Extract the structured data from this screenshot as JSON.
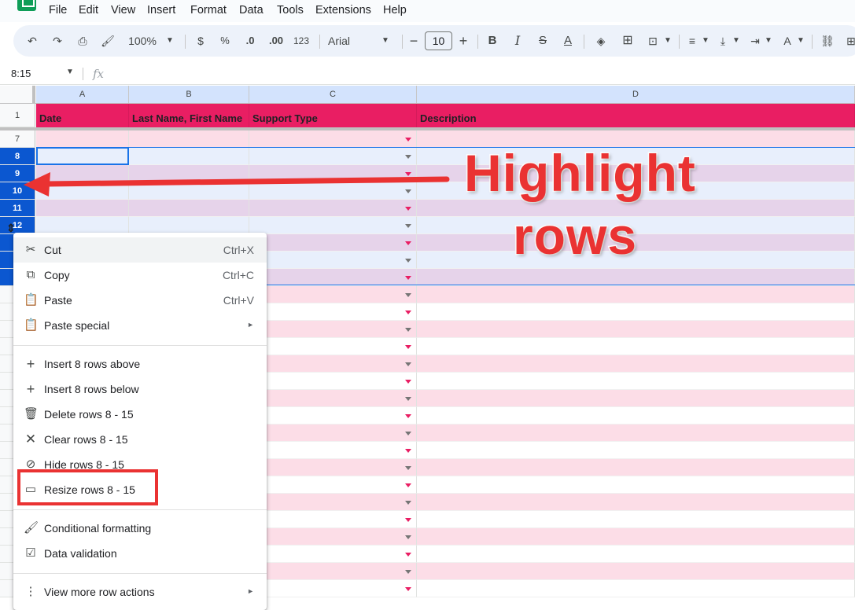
{
  "menubar": {
    "items": [
      "File",
      "Edit",
      "View",
      "Insert",
      "Format",
      "Data",
      "Tools",
      "Extensions",
      "Help"
    ]
  },
  "toolbar": {
    "zoom": "100%",
    "currency": "$",
    "percent": "%",
    "decrease_decimal": ".0",
    "increase_decimal": ".00",
    "more_formats": "123",
    "font": "Arial",
    "font_size": "10",
    "bold": "B",
    "italic": "I"
  },
  "formula_bar": {
    "name_box": "8:15",
    "fx": "fx"
  },
  "columns": [
    "A",
    "B",
    "C",
    "D"
  ],
  "header_row": {
    "number": "1",
    "cells": [
      "Date",
      "Last Name, First Name",
      "Support Type",
      "Description"
    ]
  },
  "visible_rows": [
    "7",
    "8",
    "9",
    "10",
    "11",
    "12"
  ],
  "selected_rows": [
    "8",
    "9",
    "10",
    "11",
    "12"
  ],
  "context_menu": {
    "items": [
      {
        "icon": "scissors-icon",
        "label": "Cut",
        "shortcut": "Ctrl+X"
      },
      {
        "icon": "copy-icon",
        "label": "Copy",
        "shortcut": "Ctrl+C"
      },
      {
        "icon": "paste-icon",
        "label": "Paste",
        "shortcut": "Ctrl+V"
      },
      {
        "icon": "paste-special-icon",
        "label": "Paste special",
        "submenu": "►"
      },
      {
        "icon": "plus-icon",
        "label": "Insert 8 rows above"
      },
      {
        "icon": "plus-icon",
        "label": "Insert 8 rows below"
      },
      {
        "icon": "trash-icon",
        "label": "Delete rows 8 - 15"
      },
      {
        "icon": "close-icon",
        "label": "Clear rows 8 - 15"
      },
      {
        "icon": "eye-off-icon",
        "label": "Hide rows 8 - 15"
      },
      {
        "icon": "resize-icon",
        "label": "Resize rows 8 - 15"
      },
      {
        "icon": "paint-roller-icon",
        "label": "Conditional formatting"
      },
      {
        "icon": "data-validation-icon",
        "label": "Data validation"
      },
      {
        "icon": "more-vert-icon",
        "label": "View more row actions",
        "submenu": "►"
      }
    ]
  },
  "annotation": {
    "line1": "Highlight",
    "line2": "rows",
    "color": "#ea3232"
  },
  "colors": {
    "header_fill": "#e91e63",
    "row_pink": "#fcdde7",
    "row_selected_blue": "#e8effc",
    "row_selected_purple": "#e6d3ea",
    "selection_blue": "#0b57d0"
  }
}
